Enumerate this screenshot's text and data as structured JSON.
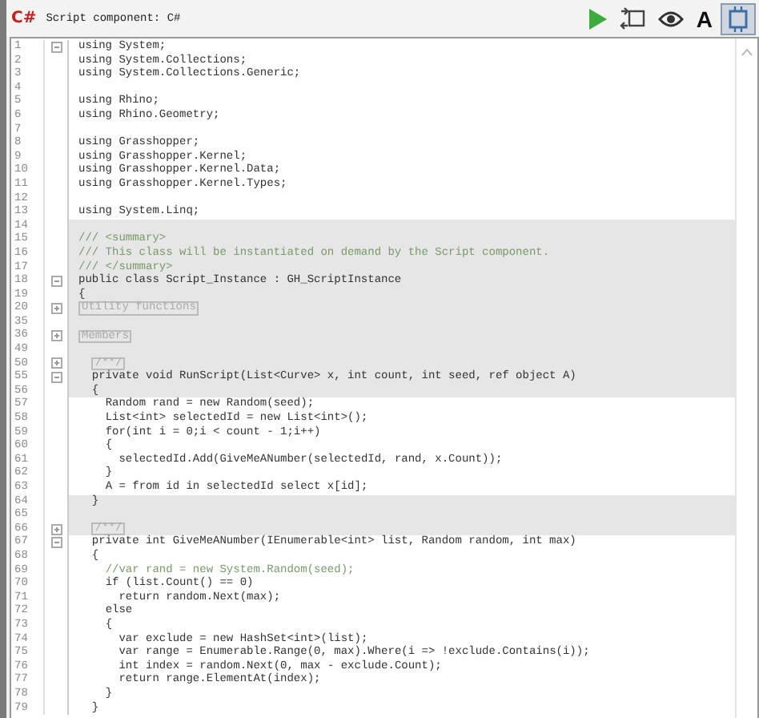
{
  "window": {
    "logo": "C#",
    "title": "Script component: C#"
  },
  "toolbar": [
    {
      "kind": "play",
      "selected": false
    },
    {
      "kind": "swap",
      "selected": false
    },
    {
      "kind": "eye",
      "selected": false
    },
    {
      "kind": "text",
      "label": "A",
      "selected": false
    },
    {
      "kind": "frame",
      "selected": true
    }
  ],
  "editor": {
    "lines": [
      {
        "number": "1",
        "expanded": true,
        "shaded": false,
        "kind": "code",
        "text": "using System;"
      },
      {
        "number": "2",
        "shaded": false,
        "kind": "code",
        "text": "using System.Collections;"
      },
      {
        "number": "3",
        "shaded": false,
        "kind": "code",
        "text": "using System.Collections.Generic;"
      },
      {
        "number": "4",
        "shaded": false
      },
      {
        "number": "5",
        "shaded": false,
        "kind": "code",
        "text": "using Rhino;"
      },
      {
        "number": "6",
        "shaded": false,
        "kind": "code",
        "text": "using Rhino.Geometry;"
      },
      {
        "number": "7",
        "shaded": false
      },
      {
        "number": "8",
        "shaded": false,
        "kind": "code",
        "text": "using Grasshopper;"
      },
      {
        "number": "9",
        "shaded": false,
        "kind": "code",
        "text": "using Grasshopper.Kernel;"
      },
      {
        "number": "10",
        "shaded": false,
        "kind": "code",
        "text": "using Grasshopper.Kernel.Data;"
      },
      {
        "number": "11",
        "shaded": false,
        "kind": "code",
        "text": "using Grasshopper.Kernel.Types;"
      },
      {
        "number": "12",
        "shaded": false
      },
      {
        "number": "13",
        "shaded": false,
        "kind": "code",
        "text": "using System.Linq;"
      },
      {
        "number": "14",
        "shaded": true
      },
      {
        "number": "15",
        "shaded": true,
        "kind": "comment",
        "text": "/// <summary>"
      },
      {
        "number": "16",
        "shaded": true,
        "kind": "comment",
        "text": "/// This class will be instantiated on demand by the Script component."
      },
      {
        "number": "17",
        "shaded": true,
        "kind": "comment",
        "text": "/// </summary>"
      },
      {
        "number": "18",
        "expanded": true,
        "shaded": true,
        "kind": "code",
        "text": "public class Script_Instance : GH_ScriptInstance"
      },
      {
        "number": "19",
        "shaded": true,
        "kind": "code",
        "text": "{"
      },
      {
        "number": "20",
        "expanded": false,
        "shaded": true,
        "kind": "region",
        "text": "Utility functions"
      },
      {
        "number": "35",
        "shaded": true
      },
      {
        "number": "36",
        "expanded": false,
        "shaded": true,
        "kind": "region",
        "text": "Members"
      },
      {
        "number": "49",
        "shaded": true
      },
      {
        "number": "50",
        "expanded": false,
        "shaded": true,
        "kind": "region",
        "text": "  /**/"
      },
      {
        "number": "55",
        "expanded": true,
        "shaded": true,
        "kind": "code",
        "text": "  private void RunScript(List<Curve> x, int count, int seed, ref object A)"
      },
      {
        "number": "56",
        "shaded": true,
        "kind": "code",
        "text": "  {"
      },
      {
        "number": "57",
        "shaded": false,
        "kind": "code",
        "text": "    Random rand = new Random(seed);"
      },
      {
        "number": "58",
        "shaded": false,
        "kind": "code",
        "text": "    List<int> selectedId = new List<int>();"
      },
      {
        "number": "59",
        "shaded": false,
        "kind": "code",
        "text": "    for(int i = 0;i < count - 1;i++)"
      },
      {
        "number": "60",
        "shaded": false,
        "kind": "code",
        "text": "    {"
      },
      {
        "number": "61",
        "shaded": false,
        "kind": "code",
        "text": "      selectedId.Add(GiveMeANumber(selectedId, rand, x.Count));"
      },
      {
        "number": "62",
        "shaded": false,
        "kind": "code",
        "text": "    }"
      },
      {
        "number": "63",
        "shaded": false,
        "kind": "code",
        "text": "    A = from id in selectedId select x[id];"
      },
      {
        "number": "64",
        "shaded": true,
        "kind": "code",
        "text": "  }"
      },
      {
        "number": "65",
        "shaded": true
      },
      {
        "number": "66",
        "expanded": false,
        "shaded": true,
        "kind": "region",
        "text": "  /**/"
      },
      {
        "number": "67",
        "expanded": true,
        "shaded": false,
        "kind": "code",
        "text": "  private int GiveMeANumber(IEnumerable<int> list, Random random, int max)"
      },
      {
        "number": "68",
        "shaded": false,
        "kind": "code",
        "text": "  {"
      },
      {
        "number": "69",
        "shaded": false,
        "kind": "comment",
        "text": "    //var rand = new System.Random(seed);"
      },
      {
        "number": "70",
        "shaded": false,
        "kind": "code",
        "text": "    if (list.Count() == 0)"
      },
      {
        "number": "71",
        "shaded": false,
        "kind": "code",
        "text": "      return random.Next(max);"
      },
      {
        "number": "72",
        "shaded": false,
        "kind": "code",
        "text": "    else"
      },
      {
        "number": "73",
        "shaded": false,
        "kind": "code",
        "text": "    {"
      },
      {
        "number": "74",
        "shaded": false,
        "kind": "code",
        "text": "      var exclude = new HashSet<int>(list);"
      },
      {
        "number": "75",
        "shaded": false,
        "kind": "code",
        "text": "      var range = Enumerable.Range(0, max).Where(i => !exclude.Contains(i));"
      },
      {
        "number": "76",
        "shaded": false,
        "kind": "code",
        "text": "      int index = random.Next(0, max - exclude.Count);"
      },
      {
        "number": "77",
        "shaded": false,
        "kind": "code",
        "text": "      return range.ElementAt(index);"
      },
      {
        "number": "78",
        "shaded": false,
        "kind": "code",
        "text": "    }"
      },
      {
        "number": "79",
        "shaded": false,
        "kind": "code",
        "text": "  }"
      }
    ]
  }
}
